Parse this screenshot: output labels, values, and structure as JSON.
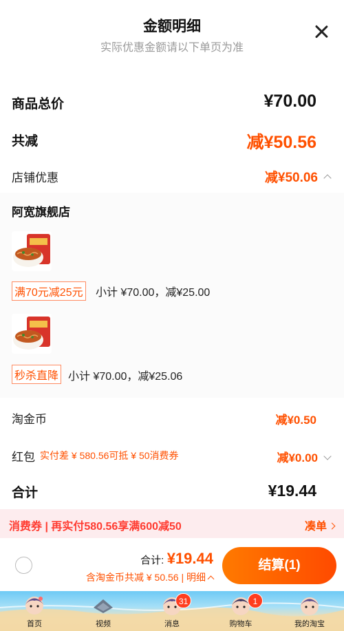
{
  "header": {
    "title": "金额明细",
    "subtitle": "实际优惠金额请以下单页为准"
  },
  "summary": {
    "goods_total_label": "商品总价",
    "goods_total_value": "¥70.00",
    "reduce_label": "共减",
    "reduce_value": "减¥50.56",
    "shop_discount_label": "店铺优惠",
    "shop_discount_value": "减¥50.06"
  },
  "store": {
    "name": "阿宽旗舰店",
    "items": [
      {
        "tag": "满70元减25元",
        "subtotal": "小计 ¥70.00，减¥25.00"
      },
      {
        "tag": "秒杀直降",
        "subtotal": "小计 ¥70.00，减¥25.06"
      }
    ]
  },
  "coins": {
    "label": "淘金币",
    "value": "减¥0.50"
  },
  "hongbao": {
    "label": "红包",
    "note": "实付差 ¥ 580.56可抵 ¥ 50消费券",
    "value": "减¥0.00"
  },
  "total": {
    "label": "合计",
    "value": "¥19.44"
  },
  "coupon_bar": {
    "text": "消费券 | 再实付580.56享满600减50",
    "link": "凑单"
  },
  "paybar": {
    "total_label": "合计:",
    "total_value": "¥19.44",
    "detail": "含淘金币共减 ¥ 50.56 | 明细",
    "checkout": "结算(1)"
  },
  "tabbar": [
    {
      "label": "首页",
      "icon": "home-avatar-icon"
    },
    {
      "label": "视频",
      "icon": "video-icon"
    },
    {
      "label": "消息",
      "icon": "message-avatar-icon",
      "badge": "31"
    },
    {
      "label": "购物车",
      "icon": "cart-avatar-icon",
      "badge": "1"
    },
    {
      "label": "我的淘宝",
      "icon": "profile-avatar-icon"
    }
  ],
  "colors": {
    "accent": "#ff5000",
    "coupon_bg": "#fdecee",
    "badge": "#ff3d1f"
  }
}
